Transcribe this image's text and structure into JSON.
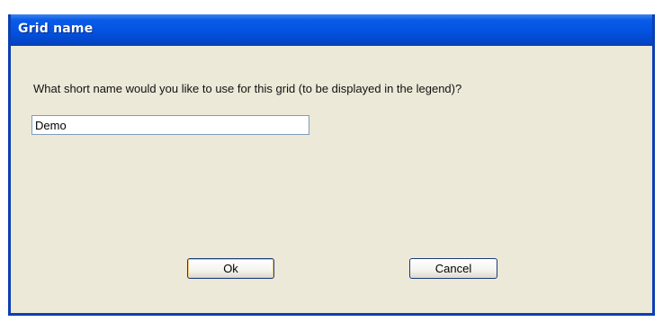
{
  "window": {
    "title": "Grid name"
  },
  "dialog": {
    "prompt": "What short name would you like to use for this grid (to be displayed in the legend)?",
    "name_value": "Demo",
    "ok_label": "Ok",
    "cancel_label": "Cancel"
  },
  "colors": {
    "titlebar": "#0352e0",
    "dialog_background": "#ece9d8",
    "title_text": "#ffffff"
  }
}
